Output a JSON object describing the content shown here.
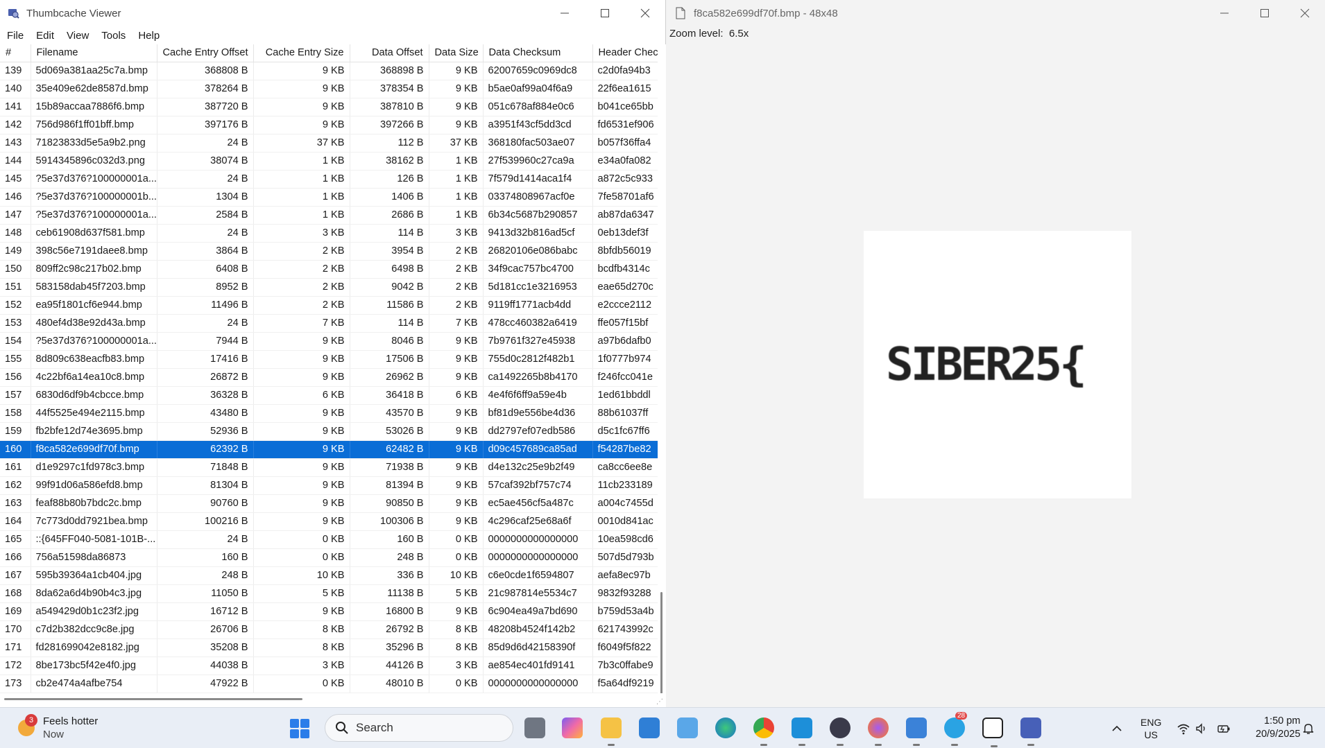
{
  "left_window": {
    "title": "Thumbcache Viewer",
    "menu": [
      "File",
      "Edit",
      "View",
      "Tools",
      "Help"
    ],
    "columns": [
      "#",
      "Filename",
      "Cache Entry Offset",
      "Cache Entry Size",
      "Data Offset",
      "Data Size",
      "Data Checksum",
      "Header Checksum"
    ],
    "selected_row": "160",
    "rows": [
      [
        "139",
        "5d069a381aa25c7a.bmp",
        "368808 B",
        "9 KB",
        "368898 B",
        "9 KB",
        "62007659c0969dc8",
        "c2d0fa94b3"
      ],
      [
        "140",
        "35e409e62de8587d.bmp",
        "378264 B",
        "9 KB",
        "378354 B",
        "9 KB",
        "b5ae0af99a04f6a9",
        "22f6ea1615"
      ],
      [
        "141",
        "15b89accaa7886f6.bmp",
        "387720 B",
        "9 KB",
        "387810 B",
        "9 KB",
        "051c678af884e0c6",
        "b041ce65bb"
      ],
      [
        "142",
        "756d986f1ff01bff.bmp",
        "397176 B",
        "9 KB",
        "397266 B",
        "9 KB",
        "a3951f43cf5dd3cd",
        "fd6531ef906"
      ],
      [
        "143",
        "71823833d5e5a9b2.png",
        "24 B",
        "37 KB",
        "112 B",
        "37 KB",
        "368180fac503ae07",
        "b057f36ffa4"
      ],
      [
        "144",
        "5914345896c032d3.png",
        "38074 B",
        "1 KB",
        "38162 B",
        "1 KB",
        "27f539960c27ca9a",
        "e34a0fa082"
      ],
      [
        "145",
        "?5e37d376?100000001a...",
        "24 B",
        "1 KB",
        "126 B",
        "1 KB",
        "7f579d1414aca1f4",
        "a872c5c933"
      ],
      [
        "146",
        "?5e37d376?100000001b...",
        "1304 B",
        "1 KB",
        "1406 B",
        "1 KB",
        "03374808967acf0e",
        "7fe58701af6"
      ],
      [
        "147",
        "?5e37d376?100000001a...",
        "2584 B",
        "1 KB",
        "2686 B",
        "1 KB",
        "6b34c5687b290857",
        "ab87da6347"
      ],
      [
        "148",
        "ceb61908d637f581.bmp",
        "24 B",
        "3 KB",
        "114 B",
        "3 KB",
        "9413d32b816ad5cf",
        "0eb13def3f"
      ],
      [
        "149",
        "398c56e7191daee8.bmp",
        "3864 B",
        "2 KB",
        "3954 B",
        "2 KB",
        "26820106e086babc",
        "8bfdb56019"
      ],
      [
        "150",
        "809ff2c98c217b02.bmp",
        "6408 B",
        "2 KB",
        "6498 B",
        "2 KB",
        "34f9cac757bc4700",
        "bcdfb4314c"
      ],
      [
        "151",
        "583158dab45f7203.bmp",
        "8952 B",
        "2 KB",
        "9042 B",
        "2 KB",
        "5d181cc1e3216953",
        "eae65d270c"
      ],
      [
        "152",
        "ea95f1801cf6e944.bmp",
        "11496 B",
        "2 KB",
        "11586 B",
        "2 KB",
        "9119ff1771acb4dd",
        "e2ccce2112"
      ],
      [
        "153",
        "480ef4d38e92d43a.bmp",
        "24 B",
        "7 KB",
        "114 B",
        "7 KB",
        "478cc460382a6419",
        "ffe057f15bf"
      ],
      [
        "154",
        "?5e37d376?100000001a...",
        "7944 B",
        "9 KB",
        "8046 B",
        "9 KB",
        "7b9761f327e45938",
        "a97b6dafb0"
      ],
      [
        "155",
        "8d809c638eacfb83.bmp",
        "17416 B",
        "9 KB",
        "17506 B",
        "9 KB",
        "755d0c2812f482b1",
        "1f0777b974"
      ],
      [
        "156",
        "4c22bf6a14ea10c8.bmp",
        "26872 B",
        "9 KB",
        "26962 B",
        "9 KB",
        "ca1492265b8b4170",
        "f246fcc041e"
      ],
      [
        "157",
        "6830d6df9b4cbcce.bmp",
        "36328 B",
        "6 KB",
        "36418 B",
        "6 KB",
        "4e4f6f6ff9a59e4b",
        "1ed61bbddl"
      ],
      [
        "158",
        "44f5525e494e2115.bmp",
        "43480 B",
        "9 KB",
        "43570 B",
        "9 KB",
        "bf81d9e556be4d36",
        "88b61037ff"
      ],
      [
        "159",
        "fb2bfe12d74e3695.bmp",
        "52936 B",
        "9 KB",
        "53026 B",
        "9 KB",
        "dd2797ef07edb586",
        "d5c1fc67ff6"
      ],
      [
        "160",
        "f8ca582e699df70f.bmp",
        "62392 B",
        "9 KB",
        "62482 B",
        "9 KB",
        "d09c457689ca85ad",
        "f54287be82"
      ],
      [
        "161",
        "d1e9297c1fd978c3.bmp",
        "71848 B",
        "9 KB",
        "71938 B",
        "9 KB",
        "d4e132c25e9b2f49",
        "ca8cc6ee8e"
      ],
      [
        "162",
        "99f91d06a586efd8.bmp",
        "81304 B",
        "9 KB",
        "81394 B",
        "9 KB",
        "57caf392bf757c74",
        "11cb233189"
      ],
      [
        "163",
        "feaf88b80b7bdc2c.bmp",
        "90760 B",
        "9 KB",
        "90850 B",
        "9 KB",
        "ec5ae456cf5a487c",
        "a004c7455d"
      ],
      [
        "164",
        "7c773d0dd7921bea.bmp",
        "100216 B",
        "9 KB",
        "100306 B",
        "9 KB",
        "4c296caf25e68a6f",
        "0010d841ac"
      ],
      [
        "165",
        "::{645FF040-5081-101B-...",
        "24 B",
        "0 KB",
        "160 B",
        "0 KB",
        "0000000000000000",
        "10ea598cd6"
      ],
      [
        "166",
        "756a51598da86873",
        "160 B",
        "0 KB",
        "248 B",
        "0 KB",
        "0000000000000000",
        "507d5d793b"
      ],
      [
        "167",
        "595b39364a1cb404.jpg",
        "248 B",
        "10 KB",
        "336 B",
        "10 KB",
        "c6e0cde1f6594807",
        "aefa8ec97b"
      ],
      [
        "168",
        "8da62a6d4b90b4c3.jpg",
        "11050 B",
        "5 KB",
        "11138 B",
        "5 KB",
        "21c987814e5534c7",
        "9832f93288"
      ],
      [
        "169",
        "a549429d0b1c23f2.jpg",
        "16712 B",
        "9 KB",
        "16800 B",
        "9 KB",
        "6c904ea49a7bd690",
        "b759d53a4b"
      ],
      [
        "170",
        "c7d2b382dcc9c8e.jpg",
        "26706 B",
        "8 KB",
        "26792 B",
        "8 KB",
        "48208b4524f142b2",
        "621743992c"
      ],
      [
        "171",
        "fd281699042e8182.jpg",
        "35208 B",
        "8 KB",
        "35296 B",
        "8 KB",
        "85d9d6d42158390f",
        "f6049f5f822"
      ],
      [
        "172",
        "8be173bc5f42e4f0.jpg",
        "44038 B",
        "3 KB",
        "44126 B",
        "3 KB",
        "ae854ec401fd9141",
        "7b3c0ffabe9"
      ],
      [
        "173",
        "cb2e474a4afbe754",
        "47922 B",
        "0 KB",
        "48010 B",
        "0 KB",
        "0000000000000000",
        "f5a64df9219"
      ]
    ]
  },
  "right_window": {
    "title": "f8ca582e699df70f.bmp - 48x48",
    "zoom_label": "Zoom level:",
    "zoom_value": "6.5x",
    "preview_text": "SIBER25{"
  },
  "taskbar": {
    "weather_title": "Feels hotter",
    "weather_sub": "Now",
    "weather_badge": "3",
    "search_label": "Search",
    "telegram_badge": "28",
    "lang_top": "ENG",
    "lang_bottom": "US",
    "time": "1:50 pm",
    "date": "20/9/2025"
  }
}
